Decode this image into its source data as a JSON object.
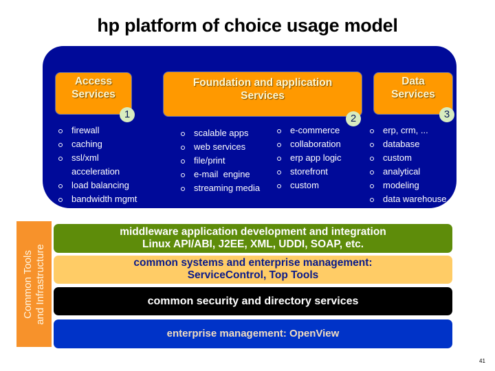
{
  "title": "hp platform of choice usage model",
  "services": [
    {
      "label_lines": [
        "Access",
        "Services"
      ],
      "badge": "1",
      "items": [
        "firewall",
        "caching",
        "ssl/xml",
        "acceleration",
        "load balancing",
        "bandwidth mgmt"
      ]
    },
    {
      "label_lines": [
        "Foundation and application",
        "Services"
      ],
      "badge": "2",
      "items_col1": [
        "scalable apps",
        "web services",
        "file/print",
        "e-mail  engine",
        "streaming media"
      ],
      "items_col2": [
        "e-commerce",
        "collaboration",
        "erp app logic",
        "storefront",
        "custom"
      ]
    },
    {
      "label_lines": [
        "Data",
        "Services"
      ],
      "badge": "3",
      "items": [
        "erp, crm, ...",
        "database",
        "custom",
        "analytical",
        "modeling",
        "data warehouse"
      ]
    }
  ],
  "sidebar": {
    "lines": [
      "Common Tools",
      "and Infrastructure"
    ]
  },
  "layers": [
    {
      "lines": [
        "middleware application development and integration",
        "Linux API/ABI, J2EE, XML, UDDI, SOAP, etc."
      ]
    },
    {
      "lines": [
        "common systems and enterprise management:",
        "ServiceControl, Top Tools"
      ]
    },
    {
      "lines": [
        "common security and directory services"
      ]
    },
    {
      "lines": [
        "enterprise management: OpenView"
      ]
    }
  ],
  "colors": {
    "panel": "#000a99",
    "service_box": "#ff9900",
    "badge": "#d8ecc0",
    "sidebar": "#f7922b",
    "layer_middleware": "#5e8c0a",
    "layer_systems": "#ffcc66",
    "layer_security": "#000000",
    "layer_openview": "#0033c8"
  },
  "page_number": "41"
}
